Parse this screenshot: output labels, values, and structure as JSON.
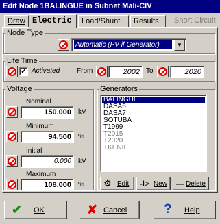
{
  "window": {
    "title": "Edit Node 1BALINGUE in Subnet Mali-CIV"
  },
  "tabs": [
    {
      "label": "Draw"
    },
    {
      "label": "Electric"
    },
    {
      "label": "Load/Shunt"
    },
    {
      "label": "Results"
    },
    {
      "label": "Short Circuit"
    }
  ],
  "node_type": {
    "group_label": "Node Type",
    "selected": "Automatic (PV if Generator)"
  },
  "life_time": {
    "group_label": "Life Time",
    "activated_checked": true,
    "activated_label": "Activated",
    "from_label": "From",
    "from_value": "2002",
    "to_label": "To",
    "to_value": "2020"
  },
  "voltage": {
    "group_label": "Voltage",
    "nominal_label": "Nominal",
    "nominal_value": "150.000",
    "nominal_unit": "kV",
    "minimum_label": "Minimum",
    "minimum_value": "94.500",
    "minimum_unit": "%",
    "initial_label": "Initial",
    "initial_value": "0.000",
    "initial_unit": "kV",
    "maximum_label": "Maximum",
    "maximum_value": "108.000",
    "maximum_unit": "%"
  },
  "generators": {
    "group_label": "Generators",
    "items": [
      {
        "name": "BALINGUE",
        "state": "selected"
      },
      {
        "name": "DASA6",
        "state": "normal"
      },
      {
        "name": "DASA7",
        "state": "normal"
      },
      {
        "name": "SOTUBA",
        "state": "normal"
      },
      {
        "name": "T1999",
        "state": "normal"
      },
      {
        "name": "T2015",
        "state": "dim"
      },
      {
        "name": "T2020",
        "state": "dim"
      },
      {
        "name": "TKENIE",
        "state": "dim"
      }
    ],
    "edit_label": "Edit",
    "new_label": "New",
    "delete_label": "Delete"
  },
  "footer": {
    "ok_label": "OK",
    "cancel_label": "Cancel",
    "help_label": "Help"
  },
  "colors": {
    "titlebar": "#000080",
    "face": "#d4d0c8",
    "accent_red": "#e00000",
    "ok_green": "#1a8a1a",
    "help_blue": "#1040c0"
  }
}
